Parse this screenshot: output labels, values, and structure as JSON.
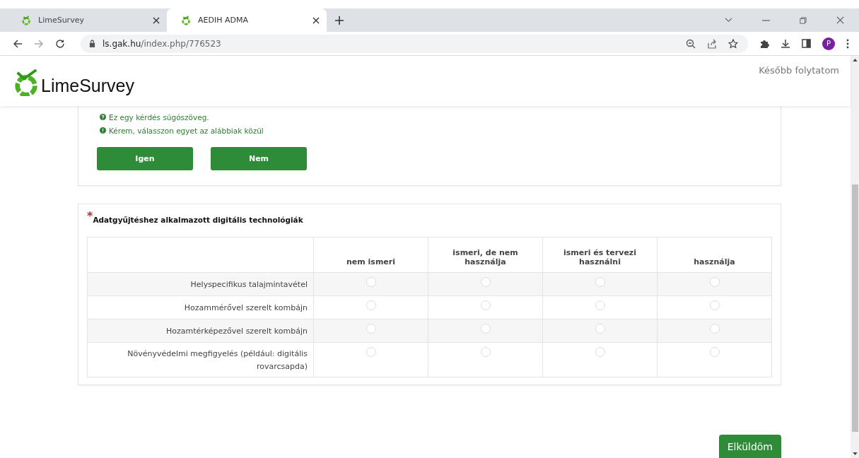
{
  "browser": {
    "tabs": [
      {
        "title": "LimeSurvey",
        "selected": false
      },
      {
        "title": "AEDIH ADMA",
        "selected": true
      }
    ],
    "address": {
      "host": "ls.gak.hu",
      "path": "/index.php/776523"
    },
    "profile_initial": "P"
  },
  "header": {
    "logo_text": "LimeSurvey",
    "resume_link": "Később folytatom"
  },
  "question_1": {
    "help": "Ez egy kérdés súgószöveg.",
    "tip": "Kérem, válasszon egyet az alábbiak közül",
    "answers": [
      "Igen",
      "Nem"
    ]
  },
  "question_2": {
    "required_mark": "*",
    "title": "Adatgyűjtéshez alkalmazott digitális technológiák",
    "columns": [
      "nem ismeri",
      "ismeri, de nem használja",
      "ismeri és tervezi használni",
      "használja"
    ],
    "rows": [
      {
        "label": "Helyspecifikus talajmintavétel",
        "choices": [
          {
            "selected": false
          },
          {
            "selected": false
          },
          {
            "selected": false
          },
          {
            "selected": false
          }
        ]
      },
      {
        "label": "Hozammérővel szerelt kombájn",
        "choices": [
          {
            "selected": false
          },
          {
            "selected": false
          },
          {
            "selected": false
          },
          {
            "selected": false
          }
        ]
      },
      {
        "label": "Hozamtérképezővel szerelt kombájn",
        "choices": [
          {
            "selected": false
          },
          {
            "selected": false
          },
          {
            "selected": false
          },
          {
            "selected": false
          }
        ]
      },
      {
        "label": "Növényvédelmi megfigyelés (például: digitális rovarcsapda)",
        "choices": [
          {
            "selected": false
          },
          {
            "selected": false
          },
          {
            "selected": false
          },
          {
            "selected": false
          }
        ]
      }
    ]
  },
  "submit_button": "Elküldöm"
}
